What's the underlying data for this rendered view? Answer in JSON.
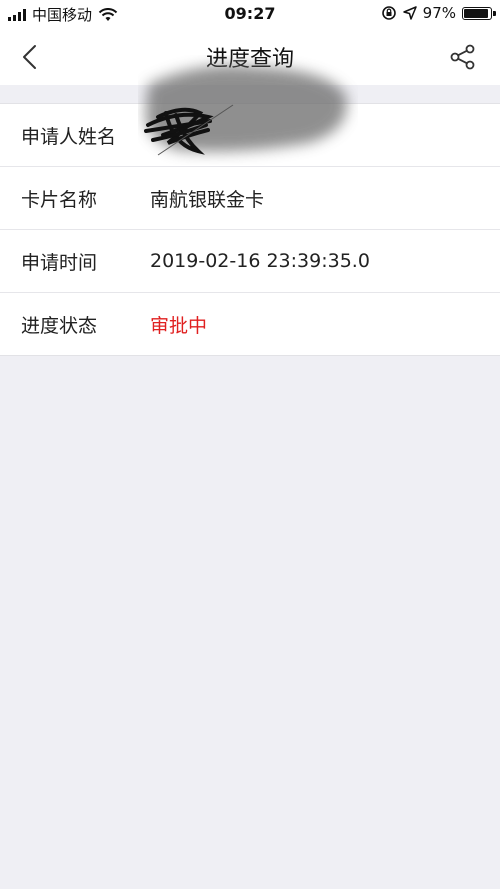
{
  "status_bar": {
    "carrier": "中国移动",
    "time": "09:27",
    "battery_percent": "97%",
    "battery_level": 0.97
  },
  "nav": {
    "title": "进度查询"
  },
  "info_rows": [
    {
      "label": "申请人姓名",
      "value": ""
    },
    {
      "label": "卡片名称",
      "value": "南航银联金卡"
    },
    {
      "label": "申请时间",
      "value": "2019-02-16 23:39:35.0"
    },
    {
      "label": "进度状态",
      "value": "审批中"
    }
  ],
  "colors": {
    "status_value": "#e02020",
    "background": "#efeff4"
  },
  "icons": {
    "back": "chevron-left-icon",
    "share": "share-icon",
    "wifi": "wifi-icon",
    "location": "location-arrow-icon",
    "lock": "orientation-lock-icon",
    "battery": "battery-icon"
  }
}
